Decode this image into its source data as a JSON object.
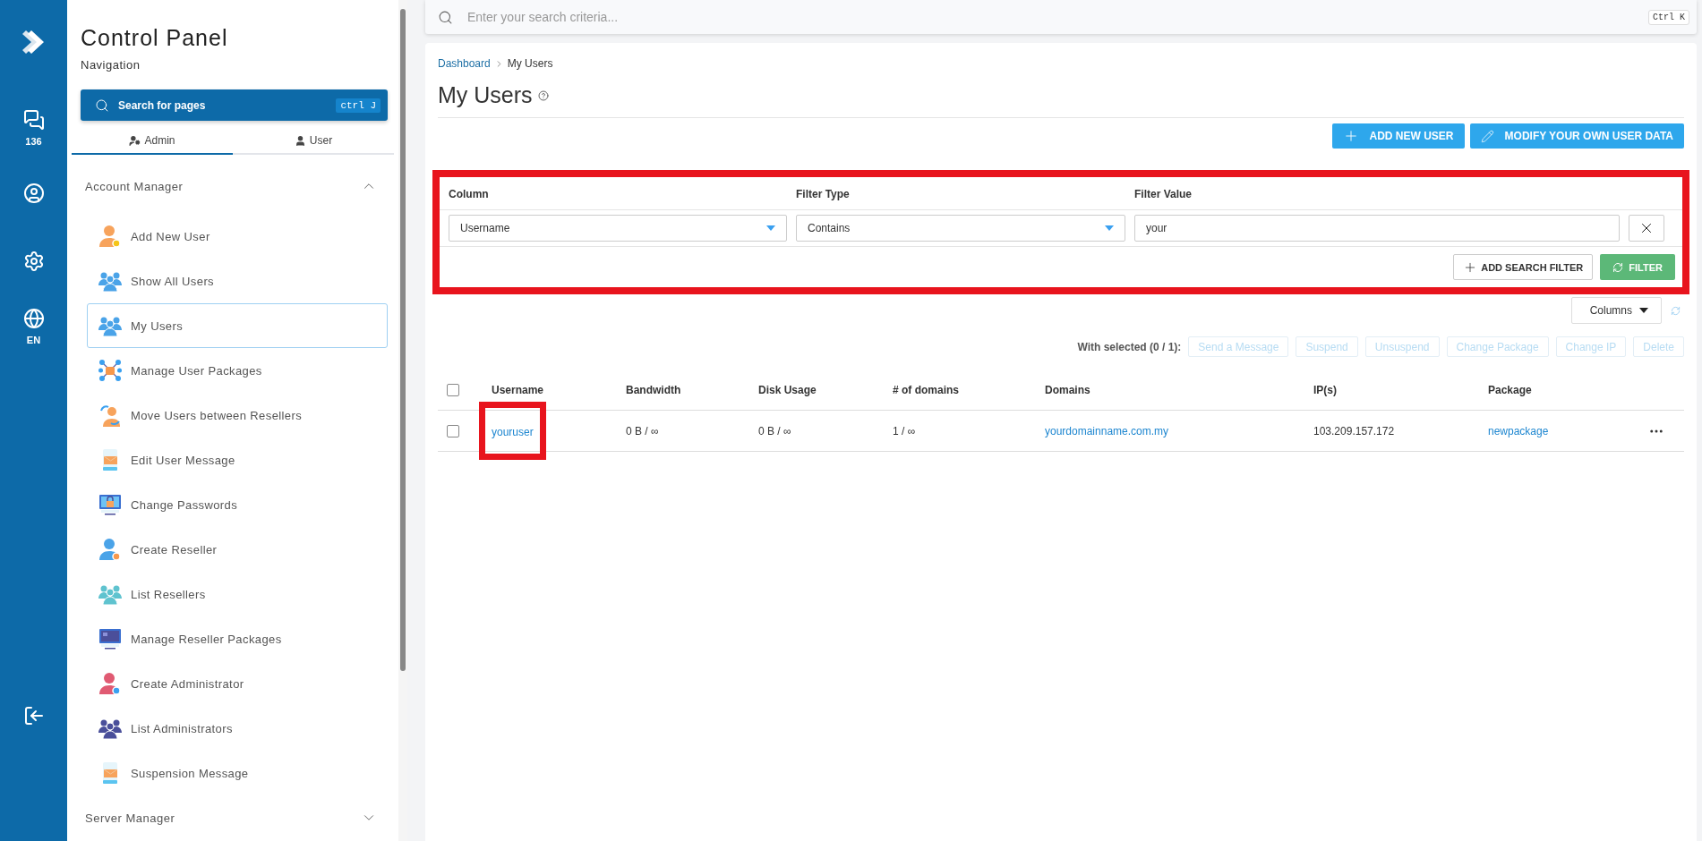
{
  "rail": {
    "chat_count": "136",
    "language": "EN"
  },
  "sidebar": {
    "title": "Control Panel",
    "subtitle": "Navigation",
    "search": {
      "placeholder": "Search for pages",
      "shortcut": "ctrl J"
    },
    "tabs": [
      {
        "label": "Admin",
        "selected": true
      },
      {
        "label": "User",
        "selected": false
      }
    ],
    "sections": [
      {
        "title": "Account Manager",
        "expanded": true,
        "items": [
          {
            "label": "Add New User",
            "selected": false
          },
          {
            "label": "Show All Users",
            "selected": false
          },
          {
            "label": "My Users",
            "selected": true
          },
          {
            "label": "Manage User Packages",
            "selected": false
          },
          {
            "label": "Move Users between Resellers",
            "selected": false
          },
          {
            "label": "Edit User Message",
            "selected": false
          },
          {
            "label": "Change Passwords",
            "selected": false
          },
          {
            "label": "Create Reseller",
            "selected": false
          },
          {
            "label": "List Resellers",
            "selected": false
          },
          {
            "label": "Manage Reseller Packages",
            "selected": false
          },
          {
            "label": "Create Administrator",
            "selected": false
          },
          {
            "label": "List Administrators",
            "selected": false
          },
          {
            "label": "Suspension Message",
            "selected": false
          }
        ]
      },
      {
        "title": "Server Manager",
        "expanded": false
      }
    ]
  },
  "top_search": {
    "placeholder": "Enter your search criteria...",
    "shortcut": "Ctrl K"
  },
  "breadcrumb": [
    "Dashboard",
    "My Users"
  ],
  "page_title": "My Users",
  "actions": [
    "ADD NEW USER",
    "MODIFY YOUR OWN USER DATA"
  ],
  "filter": {
    "highlighted": true,
    "columns": [
      "Column",
      "Filter Type",
      "Filter Value"
    ],
    "column_value": "Username",
    "type_value": "Contains",
    "value": "your",
    "add_label": "ADD SEARCH FILTER",
    "apply_label": "FILTER"
  },
  "columns_button": "Columns",
  "bulk": {
    "label": "With selected (0 / 1):",
    "actions": [
      {
        "label": "Send a Message",
        "disabled": true
      },
      {
        "label": "Suspend",
        "disabled": true
      },
      {
        "label": "Unsuspend",
        "disabled": true
      },
      {
        "label": "Change Package",
        "disabled": true
      },
      {
        "label": "Change IP",
        "disabled": true
      },
      {
        "label": "Delete",
        "disabled": true
      }
    ]
  },
  "table": {
    "header_checked": false,
    "columns": [
      "Username",
      "Bandwidth",
      "Disk Usage",
      "# of domains",
      "Domains",
      "IP(s)",
      "Package"
    ],
    "rows": [
      {
        "checked": false,
        "highlighted": true,
        "cells": [
          {
            "kind": "link",
            "text": "youruser"
          },
          {
            "kind": "text",
            "text": "0 B / ∞"
          },
          {
            "kind": "text",
            "text": "0 B / ∞"
          },
          {
            "kind": "text",
            "text": "1 / ∞"
          },
          {
            "kind": "link",
            "text": "yourdomainname.com.my"
          },
          {
            "kind": "text",
            "text": "103.209.157.172"
          },
          {
            "kind": "link",
            "text": "newpackage"
          }
        ]
      }
    ]
  }
}
